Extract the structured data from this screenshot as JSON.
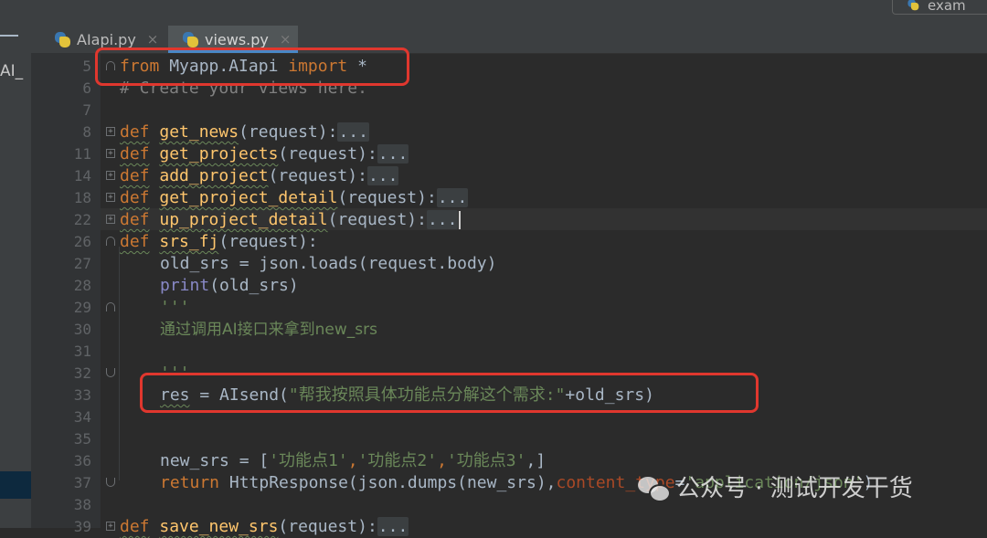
{
  "side_label": "AI_",
  "tabs": [
    {
      "label": "AIapi.py",
      "close": "×",
      "active": false
    },
    {
      "label": "views.py",
      "close": "×",
      "active": true
    }
  ],
  "run_config_label": "exam",
  "line_numbers": [
    "5",
    "6",
    "7",
    "8",
    "11",
    "14",
    "18",
    "22",
    "26",
    "27",
    "28",
    "29",
    "30",
    "31",
    "32",
    "33",
    "34",
    "35",
    "36",
    "37",
    "38",
    "39"
  ],
  "code": {
    "l5": {
      "kw1": "from",
      "mod": " Myapp.AIapi ",
      "kw2": "import",
      "rest": " *"
    },
    "l6": {
      "comment": "# Create your views here."
    },
    "l8": {
      "kw": "def",
      "fn": "get_news",
      "args": "(request):",
      "dots": "..."
    },
    "l11": {
      "kw": "def",
      "fn": "get_projects",
      "args": "(request):",
      "dots": "..."
    },
    "l14": {
      "kw": "def",
      "fn": "add_project",
      "args": "(request):",
      "dots": "..."
    },
    "l18": {
      "kw": "def",
      "fn": "get_project_detail",
      "args": "(request):",
      "dots": "..."
    },
    "l22": {
      "kw": "def",
      "fn": "up_project_detail",
      "args": "(request):",
      "dots": "..."
    },
    "l26": {
      "kw": "def",
      "fn": "srs_fj",
      "args": "(request):"
    },
    "l27": {
      "text": "old_srs = json.loads(request.body)"
    },
    "l28": {
      "bi": "print",
      "rest": "(old_srs)"
    },
    "l29": {
      "str": "'''"
    },
    "l30": {
      "str": "通过调用AI接口来拿到new_srs"
    },
    "l32": {
      "str": "'''"
    },
    "l33": {
      "var": "res",
      "mid": " = AIsend(",
      "str": "\"帮我按照具体功能点分解这个需求:\"",
      "rest": "+old_srs)"
    },
    "l36": {
      "pre": "new_srs = [",
      "s1": "'功能点1'",
      "c1": ",",
      "s2": "'功能点2'",
      "c2": ",",
      "s3": "'功能点3'",
      "post": ",]"
    },
    "l37": {
      "kw": "return",
      "mid": " HttpResponse(json.dumps(new_srs),",
      "named": "content_type",
      "eq": "=",
      "str": "'application/json'",
      "post": ")"
    },
    "l39": {
      "kw": "def",
      "fn": "save_new_srs",
      "args": "(request):",
      "dots": "..."
    }
  },
  "watermark": {
    "text": "公众号 · 测试开发干货"
  },
  "colors": {
    "highlight": "#e0372e",
    "keyword": "#cc7832",
    "function": "#ffc66d",
    "string": "#6a8759",
    "comment": "#808080",
    "builtin": "#8888c6"
  }
}
